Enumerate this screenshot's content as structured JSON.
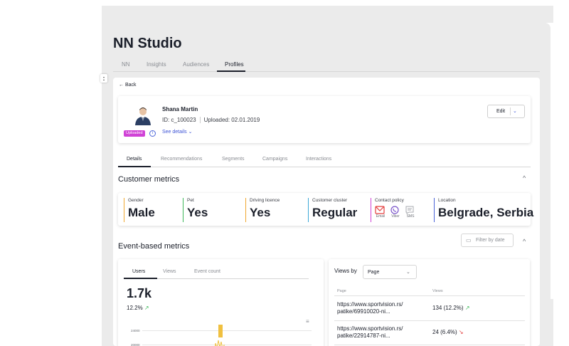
{
  "app": {
    "title": "NN Studio",
    "collapse_label": ":"
  },
  "top_tabs": [
    {
      "label": "NN"
    },
    {
      "label": "Insights"
    },
    {
      "label": "Audiences"
    },
    {
      "label": "Profiles",
      "active": true
    }
  ],
  "back_label": "← Back",
  "profile": {
    "name": "Shana Martin",
    "id": "ID: c_100023",
    "uploaded": "Uploaded: 02.01.2019",
    "badge": "Uploaded",
    "info_glyph": "i",
    "see_details": "See details",
    "edit_label": "Edit",
    "chevron": "⌄"
  },
  "detail_tabs": [
    {
      "label": "Details",
      "active": true
    },
    {
      "label": "Recommendations"
    },
    {
      "label": "Segments"
    },
    {
      "label": "Campaigns"
    },
    {
      "label": "Interactions"
    }
  ],
  "customer_metrics": {
    "title": "Customer metrics",
    "collapse_glyph": "^",
    "items": [
      {
        "label": "Gender",
        "value": "Male",
        "color": "#f0a830"
      },
      {
        "label": "Pet",
        "value": "Yes",
        "color": "#3db85a"
      },
      {
        "label": "Driving licence",
        "value": "Yes",
        "color": "#f0a830"
      },
      {
        "label": "Customer cluster",
        "value": "Regular",
        "color": "#3da8d8"
      },
      {
        "label": "Location",
        "value": "Belgrade, Serbia",
        "color": "#4a64d8"
      }
    ],
    "contact_policy": {
      "label": "Contact policy",
      "color": "#d042d6",
      "channels": [
        {
          "name": "Email",
          "icon": "email-icon"
        },
        {
          "name": "Viber",
          "icon": "viber-icon"
        },
        {
          "name": "SMS",
          "icon": "sms-icon"
        }
      ]
    }
  },
  "event_metrics": {
    "title": "Event-based metrics",
    "filter_placeholder": "Filter by date",
    "collapse_glyph": "^"
  },
  "users_panel": {
    "tabs": [
      {
        "label": "Users",
        "active": true
      },
      {
        "label": "Views"
      },
      {
        "label": "Event count"
      }
    ],
    "big_number": "1.7k",
    "change": "12.2%",
    "trend_glyph": "↗",
    "menu_glyph": "≡",
    "chart_data": {
      "type": "bar",
      "y_ticks": [
        "24000",
        "20000"
      ],
      "highlight_color": "#f0c040"
    }
  },
  "views_panel": {
    "label": "Views by",
    "select_value": "Page",
    "columns": [
      "Page",
      "Views"
    ],
    "rows": [
      {
        "url_line1": "https://www.sportvision.rs/",
        "url_line2": "patike/69910020-ni...",
        "value": "134 (12.2%)",
        "trend": "up",
        "trend_glyph": "↗"
      },
      {
        "url_line1": "https://www.sportvision.rs/",
        "url_line2": "patike/22914787-ni...",
        "value": "24 (6.4%)",
        "trend": "down",
        "trend_glyph": "↘"
      }
    ]
  }
}
